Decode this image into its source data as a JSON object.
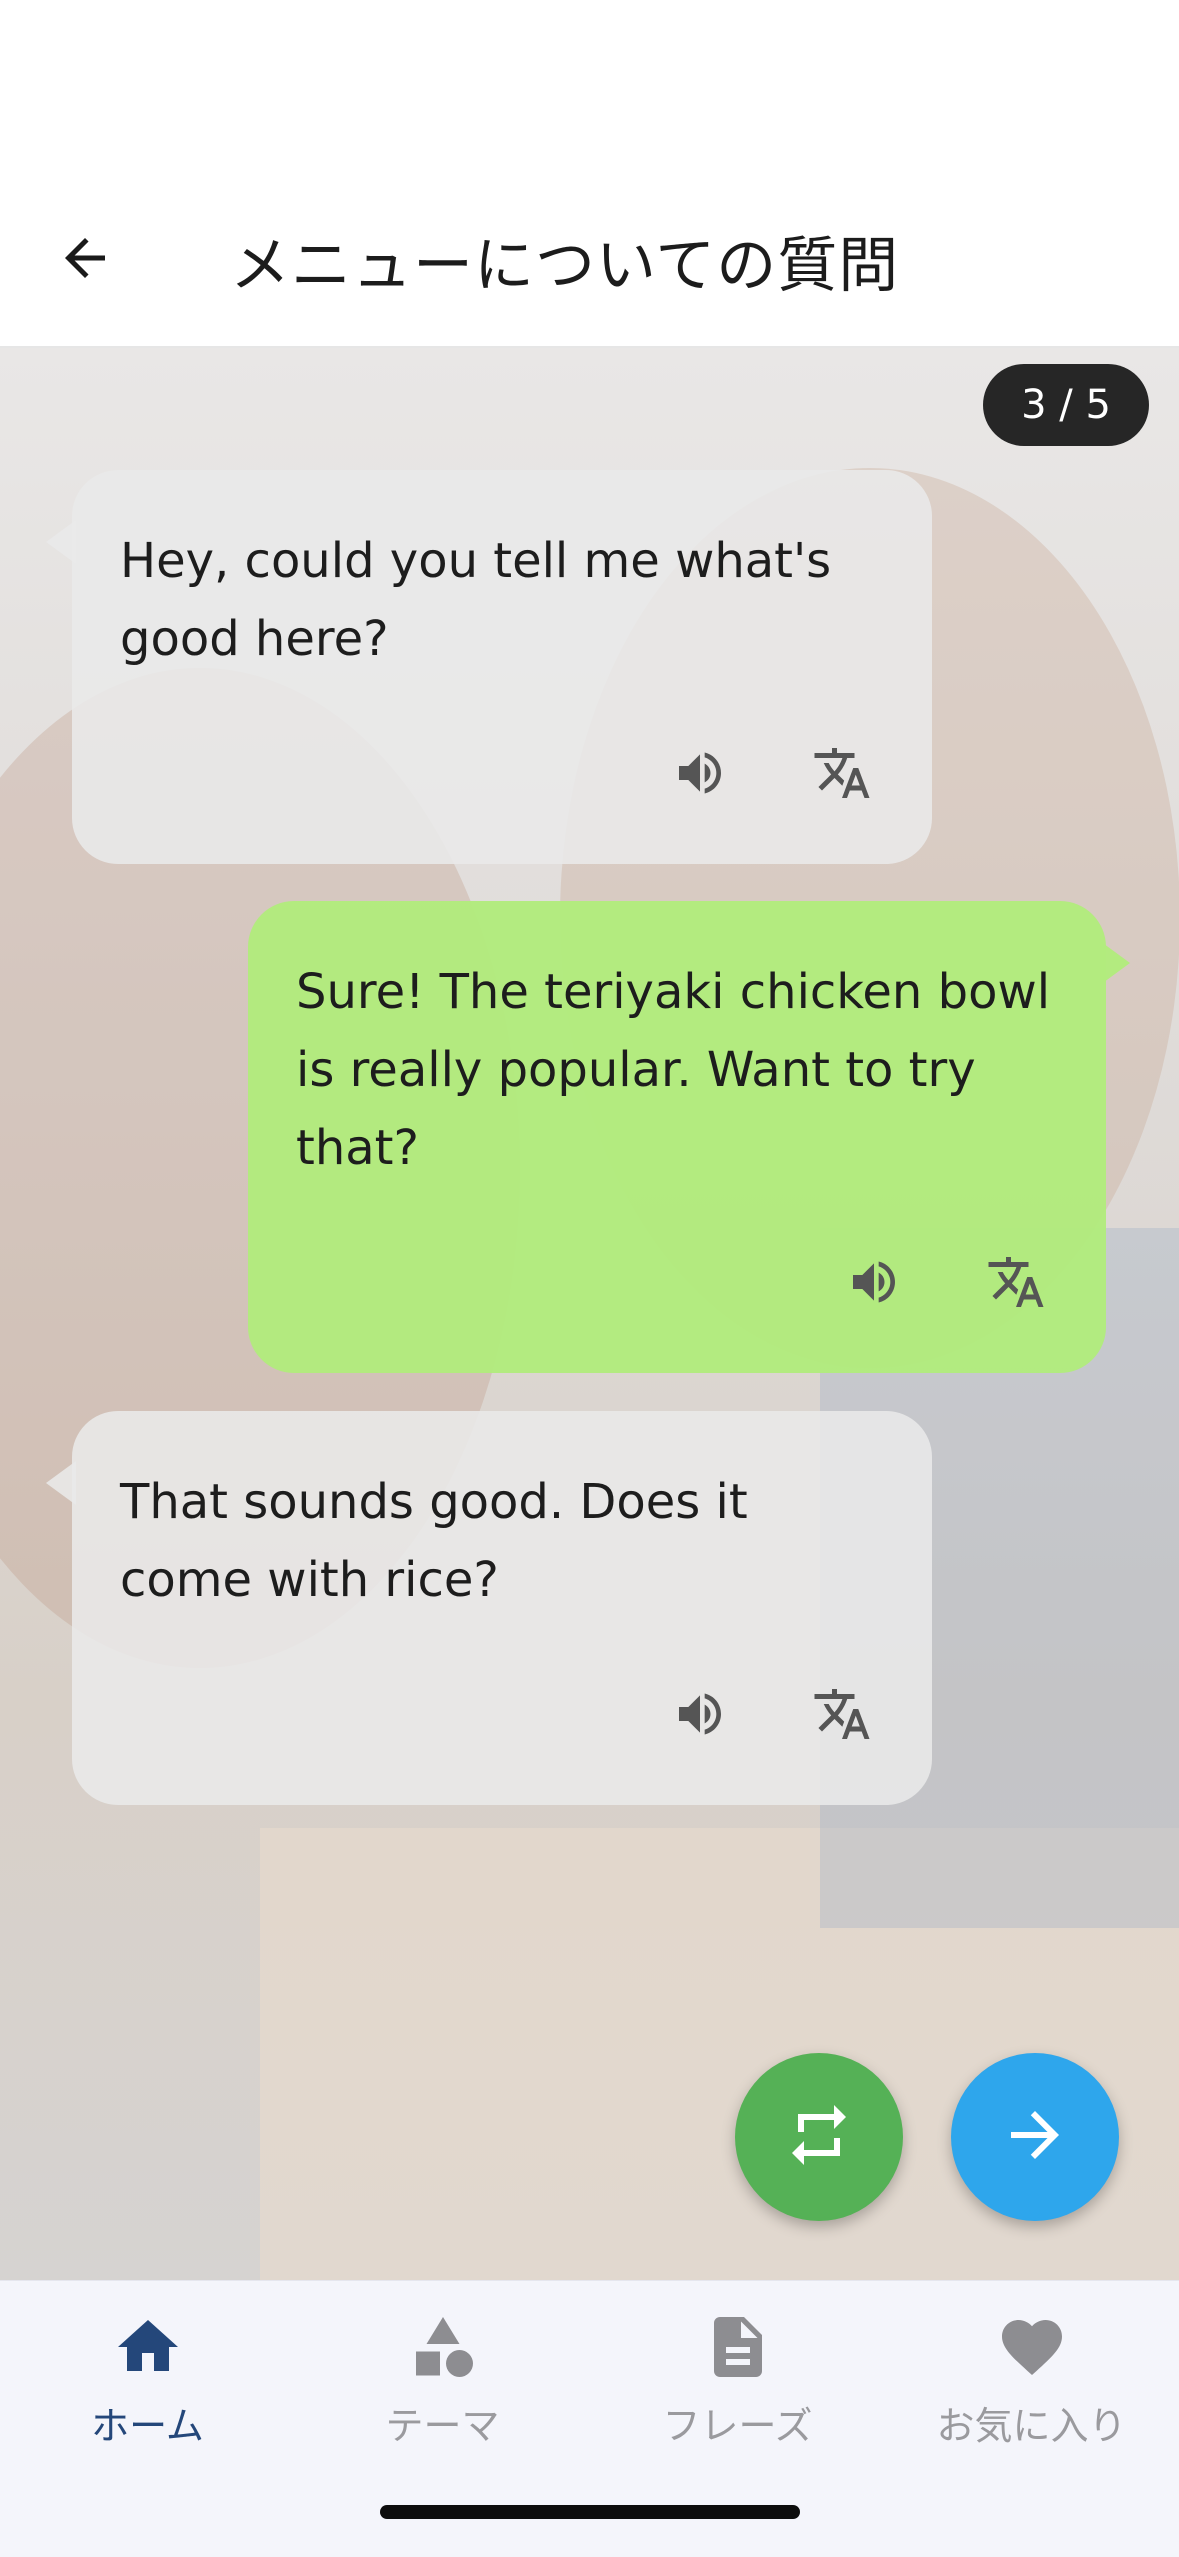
{
  "header": {
    "back_icon": "arrow-left-icon",
    "title": "メニューについての質問"
  },
  "progress": {
    "current": 3,
    "total": 5,
    "label": "3 / 5"
  },
  "messages": [
    {
      "side": "incoming",
      "text": "Hey, could you tell me what's good here?",
      "actions": [
        "speaker-icon",
        "translate-icon"
      ]
    },
    {
      "side": "outgoing",
      "text": "Sure! The teriyaki chicken bowl is really popular. Want to try that?",
      "actions": [
        "speaker-icon",
        "translate-icon"
      ]
    },
    {
      "side": "incoming",
      "text": "That sounds good. Does it come with rice?",
      "actions": [
        "speaker-icon",
        "translate-icon"
      ]
    }
  ],
  "fabs": {
    "repeat": {
      "icon": "repeat-icon",
      "color": "#55b156"
    },
    "next": {
      "icon": "arrow-right-icon",
      "color": "#2ea6ec"
    }
  },
  "bottom_nav": {
    "active_color": "#24477a",
    "items": [
      {
        "label": "ホーム",
        "icon": "home-icon",
        "active": true
      },
      {
        "label": "テーマ",
        "icon": "shapes-icon",
        "active": false
      },
      {
        "label": "フレーズ",
        "icon": "document-icon",
        "active": false
      },
      {
        "label": "お気に入り",
        "icon": "heart-icon",
        "active": false
      }
    ]
  }
}
